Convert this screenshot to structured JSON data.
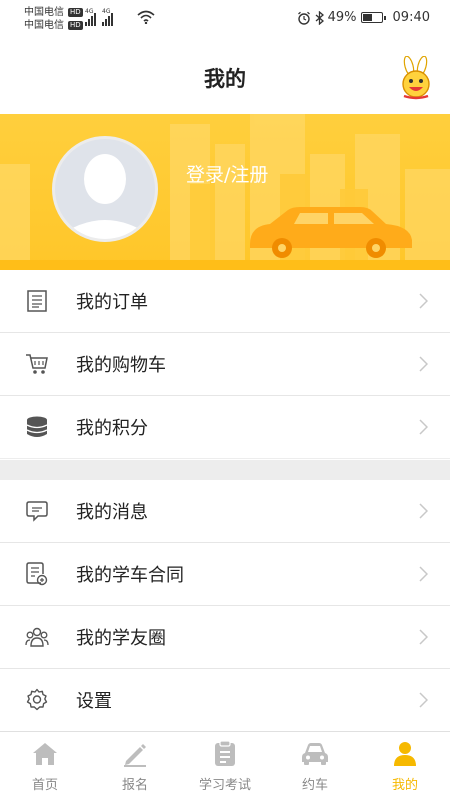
{
  "status_bar": {
    "carrier1": "中国电信",
    "carrier2": "中国电信",
    "hd_badge": "HD",
    "network1": "4G",
    "network2": "4G",
    "battery_percent": "49%",
    "battery_level": 0.49,
    "time": "09:40"
  },
  "header": {
    "title": "我的",
    "mascot_icon": "rabbit-mascot-icon"
  },
  "profile": {
    "login_label": "登录/注册",
    "avatar_icon": "default-avatar-icon"
  },
  "menu_group1": [
    {
      "label": "我的订单",
      "icon": "order-list-icon"
    },
    {
      "label": "我的购物车",
      "icon": "shopping-cart-icon"
    },
    {
      "label": "我的积分",
      "icon": "coin-stack-icon"
    }
  ],
  "menu_group2": [
    {
      "label": "我的消息",
      "icon": "message-icon"
    },
    {
      "label": "我的学车合同",
      "icon": "contract-icon"
    },
    {
      "label": "我的学友圈",
      "icon": "group-icon"
    },
    {
      "label": "设置",
      "icon": "gear-icon"
    }
  ],
  "bottom_nav": [
    {
      "label": "首页",
      "icon": "home-icon",
      "active": false
    },
    {
      "label": "报名",
      "icon": "pencil-icon",
      "active": false
    },
    {
      "label": "学习考试",
      "icon": "exam-icon",
      "active": false
    },
    {
      "label": "约车",
      "icon": "car-icon",
      "active": false
    },
    {
      "label": "我的",
      "icon": "profile-icon",
      "active": true
    }
  ],
  "colors": {
    "accent": "#f6b900",
    "banner": "#ffc629",
    "inactive": "#bdbdbd"
  }
}
